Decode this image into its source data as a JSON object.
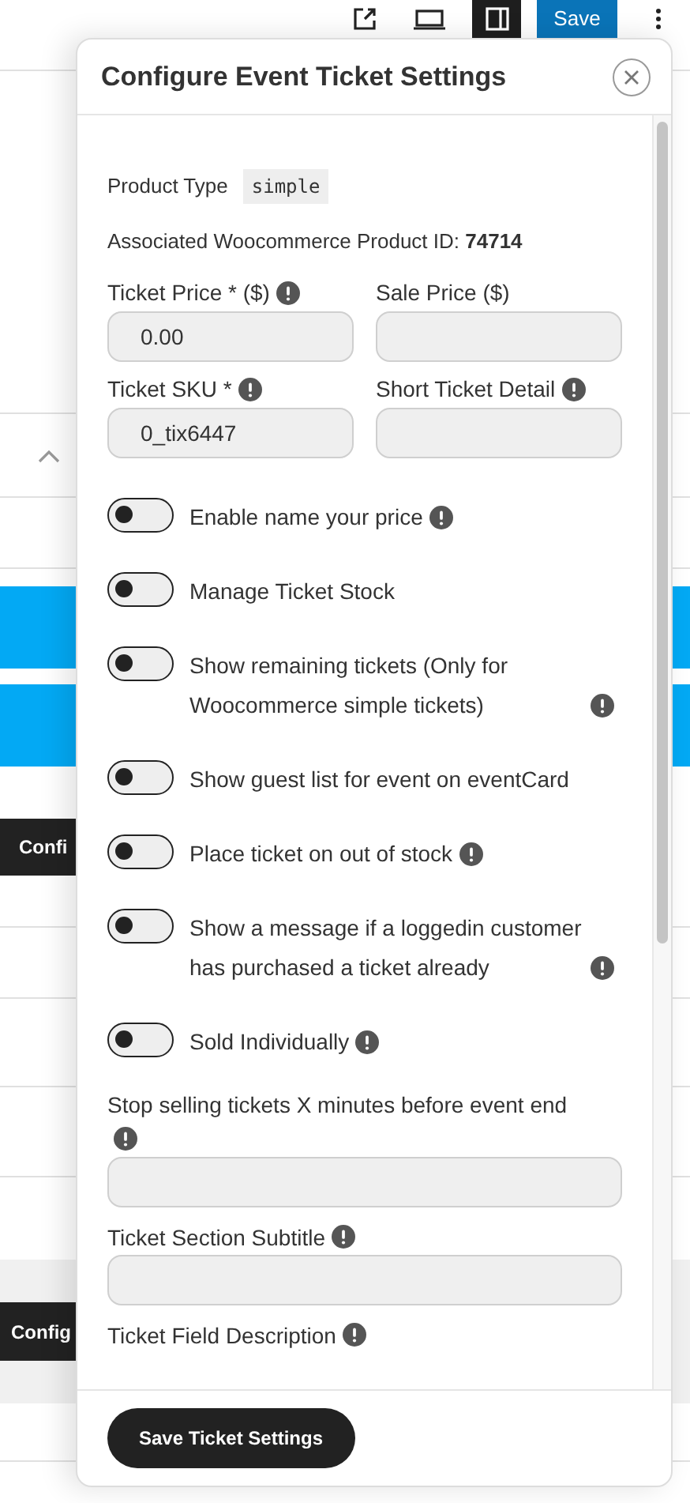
{
  "toolbar": {
    "save_label": "Save",
    "panel_toggle_selected": true
  },
  "background": {
    "buttons": [
      "Confi",
      "Config"
    ]
  },
  "modal": {
    "title": "Configure Event Ticket Settings",
    "product_type_label": "Product Type",
    "product_type_value": "simple",
    "product_id_label": "Associated Woocommerce Product ID:",
    "product_id_value": "74714",
    "pair_fields": [
      {
        "label": "Ticket Price * ($)",
        "info": true,
        "value": "0.00"
      },
      {
        "label": "Sale Price ($)",
        "info": false
      },
      {
        "label": "Ticket SKU *",
        "info": true,
        "value": "0_tix6447"
      },
      {
        "label": "Short Ticket Detail",
        "info": true
      }
    ],
    "toggles": [
      {
        "label": "Enable name your price",
        "info": true,
        "on": false
      },
      {
        "label": "Manage Ticket Stock",
        "info": false,
        "on": false
      },
      {
        "label": "Show remaining tickets (Only for Woocommerce simple tickets)",
        "info": true,
        "on": false
      },
      {
        "label": "Show guest list for event on eventCard",
        "info": false,
        "on": false
      },
      {
        "label": "Place ticket on out of stock",
        "info": true,
        "on": false
      },
      {
        "label": "Show a message if a loggedin customer has purchased a ticket already",
        "info": true,
        "on": false
      },
      {
        "label": "Sold Individually",
        "info": true,
        "on": false
      }
    ],
    "wide_fields": [
      {
        "label": "Stop selling tickets X minutes before event end",
        "info": true,
        "input": true
      },
      {
        "label": "Ticket Section Subtitle",
        "info": true,
        "input": true
      },
      {
        "label": "Ticket Field Description",
        "info": true,
        "input": false
      }
    ],
    "save_button": "Save Ticket Settings"
  }
}
